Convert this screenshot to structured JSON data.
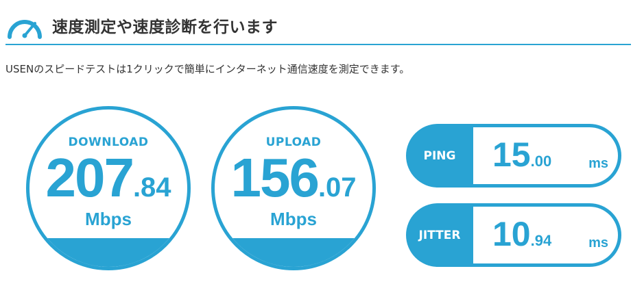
{
  "header": {
    "title": "速度測定や速度診断を行います",
    "icon": "speedometer-icon",
    "accent": "#29a3d3"
  },
  "description": "USENのスピードテストは1クリックで簡単にインターネット通信速度を測定できます。",
  "results": {
    "download": {
      "label": "DOWNLOAD",
      "int": "207",
      "dec": ".84",
      "unit": "Mbps"
    },
    "upload": {
      "label": "UPLOAD",
      "int": "156",
      "dec": ".07",
      "unit": "Mbps"
    },
    "ping": {
      "label": "PING",
      "int": "15",
      "dec": ".00",
      "unit": "ms"
    },
    "jitter": {
      "label": "JITTER",
      "int": "10",
      "dec": ".94",
      "unit": "ms"
    }
  }
}
